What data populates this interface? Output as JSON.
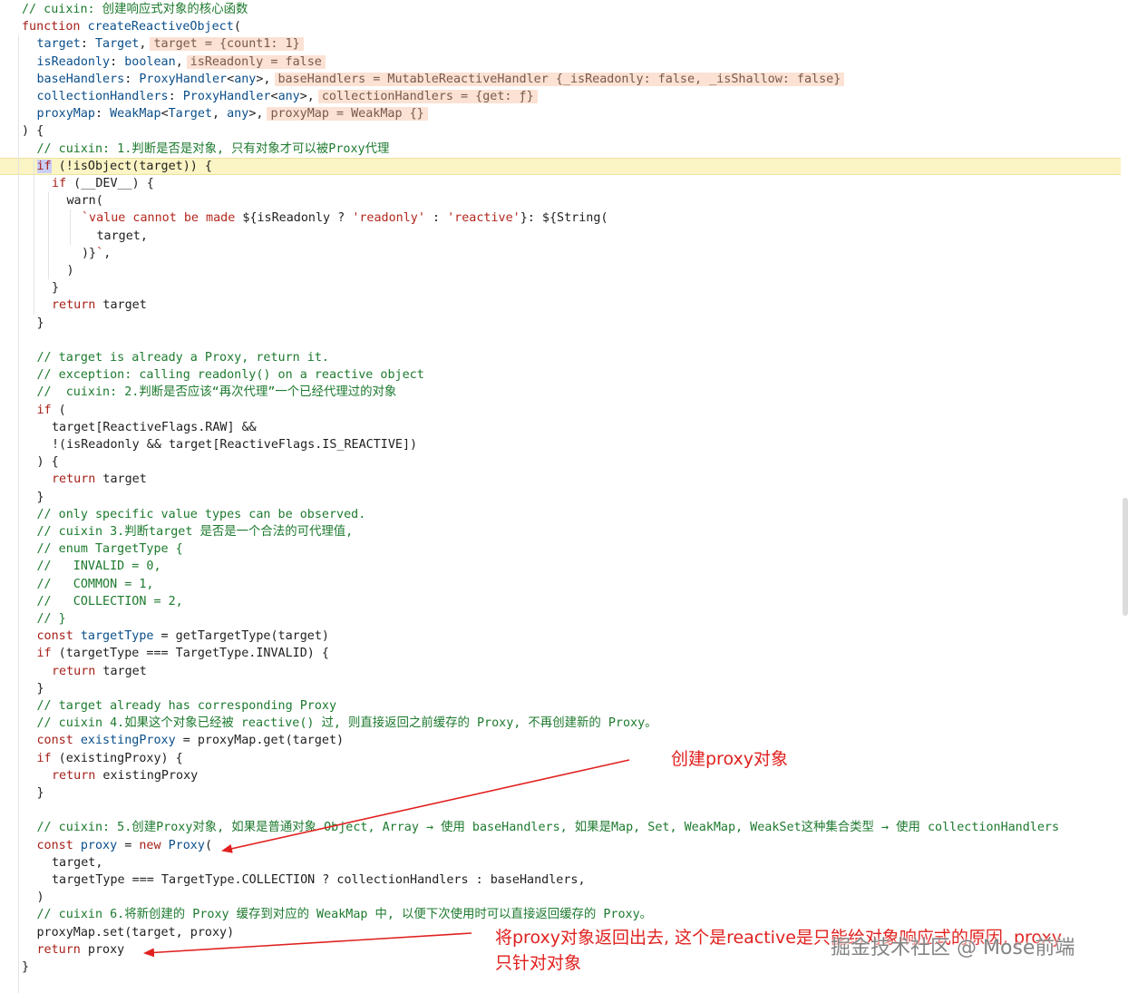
{
  "colors": {
    "keyword": "#a6211a",
    "function": "#0b4f8a",
    "string": "#b3271e",
    "comment": "#1d7a2e",
    "inlay_bg": "#fbe2d4",
    "current_line_bg": "#fbf4c4",
    "annotation_red": "#e0211f"
  },
  "code_lines": [
    {
      "indent": 1,
      "tokens": [
        {
          "t": "cm",
          "v": "// cuixin: 创建响应式对象的核心函数"
        }
      ]
    },
    {
      "indent": 1,
      "tokens": [
        {
          "t": "kw",
          "v": "function "
        },
        {
          "t": "fn",
          "v": "createReactiveObject"
        },
        {
          "t": "pl",
          "v": "("
        }
      ]
    },
    {
      "indent": 2,
      "tokens": [
        {
          "t": "var",
          "v": "target"
        },
        {
          "t": "pl",
          "v": ": "
        },
        {
          "t": "ty",
          "v": "Target"
        },
        {
          "t": "pl",
          "v": ","
        },
        {
          "t": "inlay",
          "v": "target = {count1: 1}"
        }
      ]
    },
    {
      "indent": 2,
      "tokens": [
        {
          "t": "var",
          "v": "isReadonly"
        },
        {
          "t": "pl",
          "v": ": "
        },
        {
          "t": "ty",
          "v": "boolean"
        },
        {
          "t": "pl",
          "v": ","
        },
        {
          "t": "inlay",
          "v": "isReadonly = false"
        }
      ]
    },
    {
      "indent": 2,
      "tokens": [
        {
          "t": "var",
          "v": "baseHandlers"
        },
        {
          "t": "pl",
          "v": ": "
        },
        {
          "t": "ty",
          "v": "ProxyHandler"
        },
        {
          "t": "pl",
          "v": "<"
        },
        {
          "t": "ty",
          "v": "any"
        },
        {
          "t": "pl",
          "v": ">,"
        },
        {
          "t": "inlay",
          "v": "baseHandlers = MutableReactiveHandler {_isReadonly: false, _isShallow: false}"
        }
      ]
    },
    {
      "indent": 2,
      "tokens": [
        {
          "t": "var",
          "v": "collectionHandlers"
        },
        {
          "t": "pl",
          "v": ": "
        },
        {
          "t": "ty",
          "v": "ProxyHandler"
        },
        {
          "t": "pl",
          "v": "<"
        },
        {
          "t": "ty",
          "v": "any"
        },
        {
          "t": "pl",
          "v": ">,"
        },
        {
          "t": "inlay",
          "v": "collectionHandlers = {get: ƒ}"
        }
      ]
    },
    {
      "indent": 2,
      "tokens": [
        {
          "t": "var",
          "v": "proxyMap"
        },
        {
          "t": "pl",
          "v": ": "
        },
        {
          "t": "ty",
          "v": "WeakMap"
        },
        {
          "t": "pl",
          "v": "<"
        },
        {
          "t": "ty",
          "v": "Target"
        },
        {
          "t": "pl",
          "v": ", "
        },
        {
          "t": "ty",
          "v": "any"
        },
        {
          "t": "pl",
          "v": ">,"
        },
        {
          "t": "inlay",
          "v": "proxyMap = WeakMap {}"
        }
      ]
    },
    {
      "indent": 0,
      "tokens": [
        {
          "t": "pl",
          "v": ") {"
        }
      ]
    },
    {
      "indent": 2,
      "tokens": [
        {
          "t": "cm",
          "v": "// cuixin: 1.判断是否是对象, 只有对象才可以被Proxy代理"
        }
      ]
    },
    {
      "indent": 2,
      "current": true,
      "tokens": [
        {
          "t": "kwsel",
          "v": "if"
        },
        {
          "t": "pl",
          "v": " (!isObject(target)) {"
        }
      ]
    },
    {
      "indent": 3,
      "tokens": [
        {
          "t": "kw",
          "v": "if"
        },
        {
          "t": "pl",
          "v": " (__DEV__) {"
        }
      ]
    },
    {
      "indent": 4,
      "tokens": [
        {
          "t": "pl",
          "v": "warn("
        }
      ]
    },
    {
      "indent": 5,
      "tokens": [
        {
          "t": "str",
          "v": "`value cannot be made "
        },
        {
          "t": "pl",
          "v": "${isReadonly ? "
        },
        {
          "t": "str",
          "v": "'readonly'"
        },
        {
          "t": "pl",
          "v": " : "
        },
        {
          "t": "str",
          "v": "'reactive'"
        },
        {
          "t": "pl",
          "v": "}: ${String("
        }
      ]
    },
    {
      "indent": 6,
      "tokens": [
        {
          "t": "pl",
          "v": "target,"
        }
      ]
    },
    {
      "indent": 5,
      "tokens": [
        {
          "t": "pl",
          "v": ")}"
        },
        {
          "t": "str",
          "v": "`"
        },
        {
          "t": "pl",
          "v": ","
        }
      ]
    },
    {
      "indent": 4,
      "tokens": [
        {
          "t": "pl",
          "v": ")"
        }
      ]
    },
    {
      "indent": 3,
      "tokens": [
        {
          "t": "pl",
          "v": "}"
        }
      ]
    },
    {
      "indent": 3,
      "tokens": [
        {
          "t": "kw",
          "v": "return"
        },
        {
          "t": "pl",
          "v": " target"
        }
      ]
    },
    {
      "indent": 2,
      "tokens": [
        {
          "t": "pl",
          "v": "}"
        }
      ]
    },
    {
      "indent": 0,
      "tokens": []
    },
    {
      "indent": 2,
      "tokens": [
        {
          "t": "cm",
          "v": "// target is already a Proxy, return it."
        }
      ]
    },
    {
      "indent": 2,
      "tokens": [
        {
          "t": "cm",
          "v": "// exception: calling readonly() on a reactive object"
        }
      ]
    },
    {
      "indent": 2,
      "tokens": [
        {
          "t": "cm",
          "v": "//  cuixin: 2.判断是否应该“再次代理”一个已经代理过的对象"
        }
      ]
    },
    {
      "indent": 2,
      "tokens": [
        {
          "t": "kw",
          "v": "if"
        },
        {
          "t": "pl",
          "v": " ("
        }
      ]
    },
    {
      "indent": 3,
      "tokens": [
        {
          "t": "pl",
          "v": "target[ReactiveFlags.RAW] &&"
        }
      ]
    },
    {
      "indent": 3,
      "tokens": [
        {
          "t": "pl",
          "v": "!(isReadonly && target[ReactiveFlags.IS_REACTIVE])"
        }
      ]
    },
    {
      "indent": 2,
      "tokens": [
        {
          "t": "pl",
          "v": ") {"
        }
      ]
    },
    {
      "indent": 3,
      "tokens": [
        {
          "t": "kw",
          "v": "return"
        },
        {
          "t": "pl",
          "v": " target"
        }
      ]
    },
    {
      "indent": 2,
      "tokens": [
        {
          "t": "pl",
          "v": "}"
        }
      ]
    },
    {
      "indent": 2,
      "tokens": [
        {
          "t": "cm",
          "v": "// only specific value types can be observed."
        }
      ]
    },
    {
      "indent": 2,
      "tokens": [
        {
          "t": "cm",
          "v": "// cuixin 3.判断target 是否是一个合法的可代理值,"
        }
      ]
    },
    {
      "indent": 2,
      "tokens": [
        {
          "t": "cm",
          "v": "// enum TargetType {"
        }
      ]
    },
    {
      "indent": 2,
      "tokens": [
        {
          "t": "cm",
          "v": "//   INVALID = 0,"
        }
      ]
    },
    {
      "indent": 2,
      "tokens": [
        {
          "t": "cm",
          "v": "//   COMMON = 1,"
        }
      ]
    },
    {
      "indent": 2,
      "tokens": [
        {
          "t": "cm",
          "v": "//   COLLECTION = 2,"
        }
      ]
    },
    {
      "indent": 2,
      "tokens": [
        {
          "t": "cm",
          "v": "// }"
        }
      ]
    },
    {
      "indent": 2,
      "tokens": [
        {
          "t": "kw",
          "v": "const "
        },
        {
          "t": "var",
          "v": "targetType"
        },
        {
          "t": "pl",
          "v": " = getTargetType(target)"
        }
      ]
    },
    {
      "indent": 2,
      "tokens": [
        {
          "t": "kw",
          "v": "if"
        },
        {
          "t": "pl",
          "v": " (targetType === TargetType.INVALID) {"
        }
      ]
    },
    {
      "indent": 3,
      "tokens": [
        {
          "t": "kw",
          "v": "return"
        },
        {
          "t": "pl",
          "v": " target"
        }
      ]
    },
    {
      "indent": 2,
      "tokens": [
        {
          "t": "pl",
          "v": "}"
        }
      ]
    },
    {
      "indent": 2,
      "tokens": [
        {
          "t": "cm",
          "v": "// target already has corresponding Proxy"
        }
      ]
    },
    {
      "indent": 2,
      "tokens": [
        {
          "t": "cm",
          "v": "// cuixin 4.如果这个对象已经被 reactive() 过, 则直接返回之前缓存的 Proxy, 不再创建新的 Proxy。"
        }
      ]
    },
    {
      "indent": 2,
      "tokens": [
        {
          "t": "kw",
          "v": "const "
        },
        {
          "t": "var",
          "v": "existingProxy"
        },
        {
          "t": "pl",
          "v": " = proxyMap.get(target)"
        }
      ]
    },
    {
      "indent": 2,
      "tokens": [
        {
          "t": "kw",
          "v": "if"
        },
        {
          "t": "pl",
          "v": " (existingProxy) {"
        }
      ]
    },
    {
      "indent": 3,
      "tokens": [
        {
          "t": "kw",
          "v": "return"
        },
        {
          "t": "pl",
          "v": " existingProxy"
        }
      ]
    },
    {
      "indent": 2,
      "tokens": [
        {
          "t": "pl",
          "v": "}"
        }
      ]
    },
    {
      "indent": 0,
      "tokens": []
    },
    {
      "indent": 2,
      "tokens": [
        {
          "t": "cm",
          "v": "// cuixin: 5.创建Proxy对象, 如果是普通对象 Object, Array → 使用 baseHandlers, 如果是Map, Set, WeakMap, WeakSet这种集合类型 → 使用 collectionHandlers"
        }
      ]
    },
    {
      "indent": 2,
      "tokens": [
        {
          "t": "kw",
          "v": "const "
        },
        {
          "t": "var",
          "v": "proxy"
        },
        {
          "t": "pl",
          "v": " = "
        },
        {
          "t": "kw",
          "v": "new "
        },
        {
          "t": "fn",
          "v": "Proxy"
        },
        {
          "t": "pl",
          "v": "("
        }
      ]
    },
    {
      "indent": 3,
      "tokens": [
        {
          "t": "pl",
          "v": "target,"
        }
      ]
    },
    {
      "indent": 3,
      "tokens": [
        {
          "t": "pl",
          "v": "targetType === TargetType.COLLECTION ? collectionHandlers : baseHandlers,"
        }
      ]
    },
    {
      "indent": 2,
      "tokens": [
        {
          "t": "pl",
          "v": ")"
        }
      ]
    },
    {
      "indent": 2,
      "tokens": [
        {
          "t": "cm",
          "v": "// cuixin 6.将新创建的 Proxy 缓存到对应的 WeakMap 中, 以便下次使用时可以直接返回缓存的 Proxy。"
        }
      ]
    },
    {
      "indent": 2,
      "tokens": [
        {
          "t": "pl",
          "v": "proxyMap.set(target, proxy)"
        }
      ]
    },
    {
      "indent": 2,
      "tokens": [
        {
          "t": "kw",
          "v": "return"
        },
        {
          "t": "pl",
          "v": " proxy"
        }
      ]
    },
    {
      "indent": 1,
      "tokens": [
        {
          "t": "pl",
          "v": "}"
        }
      ]
    }
  ],
  "annotations": {
    "create_proxy": "创建proxy对象",
    "return_proxy_line1": "将proxy对象返回出去, 这个是reactive是只能给对象响应式的原因, proxy",
    "return_proxy_line2": "只针对对象"
  },
  "watermark": "掘金技术社区 @ Mose前端"
}
